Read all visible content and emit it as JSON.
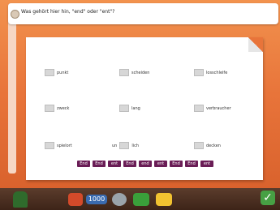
{
  "question": "Was gehört hier hin, \"end\" oder \"ent\"?",
  "items": [
    {
      "word": "punkt"
    },
    {
      "word": "scheiden"
    },
    {
      "word": "losschleife"
    },
    {
      "word": "zweck"
    },
    {
      "word": "lang"
    },
    {
      "word": "verbraucher"
    },
    {
      "word": "spielort"
    },
    {
      "prefix": "un",
      "word": "lich"
    },
    {
      "word": "decken"
    }
  ],
  "tiles": [
    "End",
    "End",
    "ent",
    "End",
    "end",
    "ent",
    "End",
    "End",
    "ent"
  ],
  "toolbar": {
    "icons": [
      "character-icon",
      "back-button-icon",
      "score-display-icon",
      "help-icon",
      "book-icon",
      "menu-icon",
      "check-icon"
    ],
    "score_display": "1000"
  }
}
